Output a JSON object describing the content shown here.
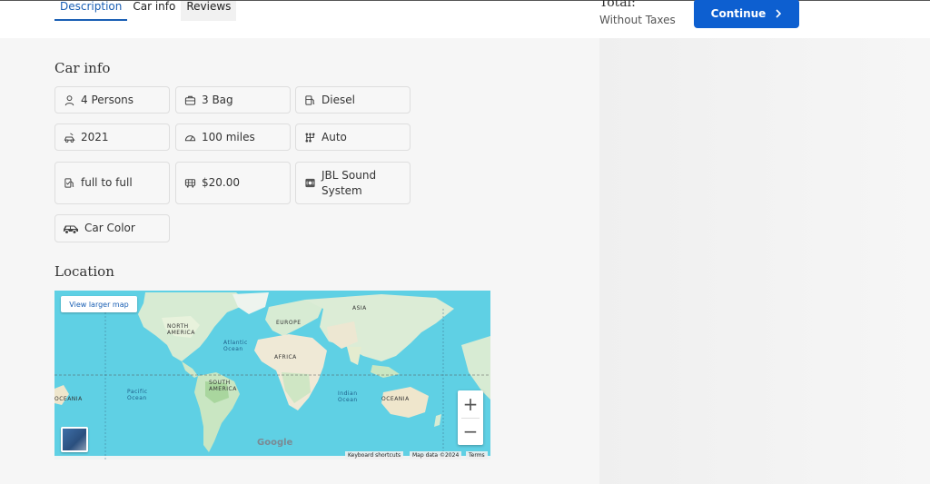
{
  "tabs": [
    {
      "label": "Description",
      "active": true
    },
    {
      "label": "Car info",
      "active": false
    },
    {
      "label": "Reviews",
      "active": false
    }
  ],
  "summary": {
    "total_label": "Total:",
    "tax_label": "Without Taxes",
    "continue_label": "Continue"
  },
  "car_info": {
    "title": "Car info",
    "features": [
      {
        "icon": "person-icon",
        "label": "4 Persons"
      },
      {
        "icon": "bag-icon",
        "label": "3 Bag"
      },
      {
        "icon": "fuel-icon",
        "label": "Diesel"
      },
      {
        "icon": "car-year-icon",
        "label": "2021"
      },
      {
        "icon": "speedometer-icon",
        "label": "100 miles"
      },
      {
        "icon": "transmission-icon",
        "label": "Auto"
      },
      {
        "icon": "fuel-policy-icon",
        "label": "full to full"
      },
      {
        "icon": "deposit-icon",
        "label": "$20.00"
      },
      {
        "icon": "speaker-icon",
        "label": "JBL Sound System"
      },
      {
        "icon": "car-icon",
        "label": "Car Color"
      }
    ]
  },
  "location": {
    "title": "Location",
    "view_larger_map": "View larger map",
    "zoom_in": "+",
    "zoom_out": "−",
    "attribution": {
      "shortcuts": "Keyboard shortcuts",
      "map_data": "Map data ©2024",
      "terms": "Terms"
    },
    "logo_text": "Google",
    "labels": {
      "north_america": "NORTH\nAMERICA",
      "europe": "EUROPE",
      "asia": "ASIA",
      "africa": "AFRICA",
      "south_america": "SOUTH\nAMERICA",
      "oceania_left": "OCEANIA",
      "oceania_right": "OCEANIA",
      "atlantic": "Atlantic\nOcean",
      "pacific": "Pacific\nOcean",
      "indian": "Indian\nOcean"
    }
  },
  "colors": {
    "accent": "#0d5fd0",
    "ocean": "#5fd0e4",
    "land": "#d9ecd5"
  }
}
